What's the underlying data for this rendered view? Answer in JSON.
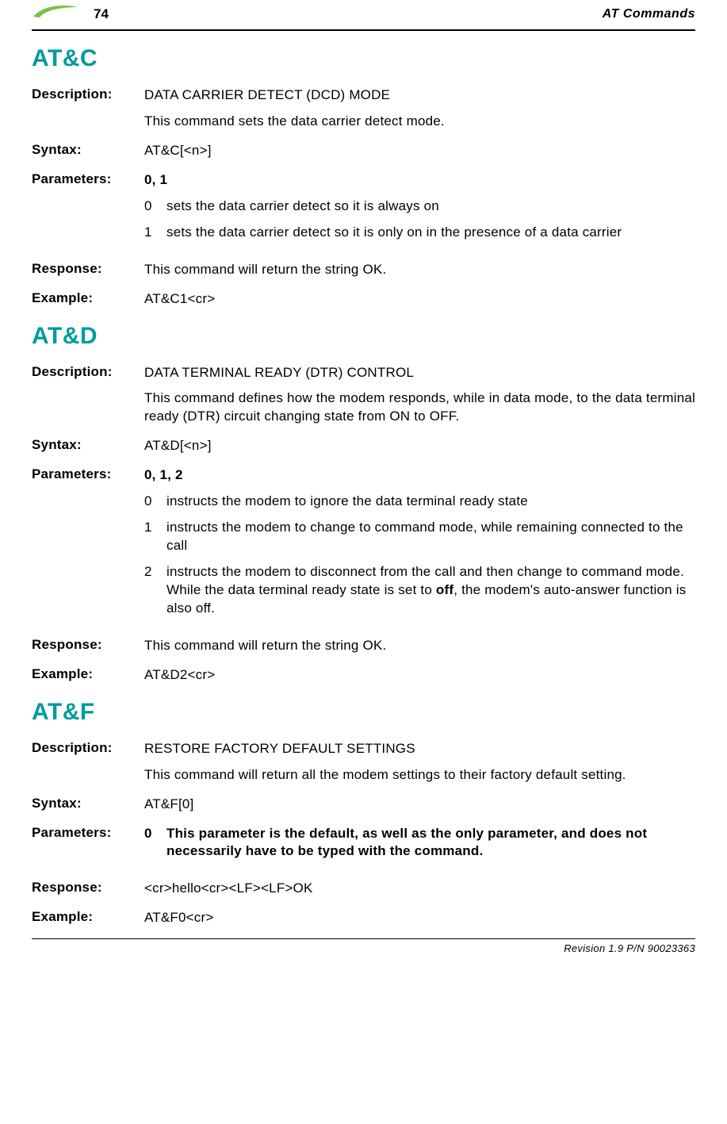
{
  "header": {
    "page_number": "74",
    "title": "AT Commands"
  },
  "logo": {
    "fill": "#7BC043"
  },
  "sections": {
    "atc": {
      "heading": "AT&C",
      "description_label": "Description:",
      "description_title": "DATA CARRIER DETECT (DCD) MODE",
      "description_text": "This command sets the data carrier detect mode.",
      "syntax_label": "Syntax:",
      "syntax_value": "AT&C[<n>]",
      "params_label": "Parameters:",
      "params_value": "0, 1",
      "params_items": [
        {
          "k": "0",
          "v": "sets the data carrier detect so it is always on"
        },
        {
          "k": "1",
          "v": "sets the data carrier detect so it is only on in the presence of a data carrier"
        }
      ],
      "response_label": "Response:",
      "response_value": "This command will return the string OK.",
      "example_label": "Example:",
      "example_value": "AT&C1<cr>"
    },
    "atd": {
      "heading": "AT&D",
      "description_label": "Description:",
      "description_title": "DATA TERMINAL READY (DTR) CONTROL",
      "description_text": "This command defines how the modem responds, while in data mode, to the data terminal ready (DTR) circuit changing state from ON to OFF.",
      "syntax_label": "Syntax:",
      "syntax_value": "AT&D[<n>]",
      "params_label": "Parameters:",
      "params_value": "0, 1, 2",
      "params_items": [
        {
          "k": "0",
          "v": "instructs the modem to ignore the data terminal ready state"
        },
        {
          "k": "1",
          "v": "instructs the modem to change to command mode, while remaining connected to the call"
        }
      ],
      "params_item_2": {
        "k": "2",
        "pre": "instructs the modem to disconnect from the call and then change to command mode. While the data terminal ready state is set to ",
        "bold": "off",
        "post": ", the modem's auto-answer function is also off."
      },
      "response_label": "Response:",
      "response_value": "This command will return the string OK.",
      "example_label": "Example:",
      "example_value": "AT&D2<cr>"
    },
    "atf": {
      "heading": "AT&F",
      "description_label": "Description:",
      "description_title": "RESTORE FACTORY DEFAULT SETTINGS",
      "description_text": "This command will return all the modem settings to their factory default setting.",
      "syntax_label": "Syntax:",
      "syntax_value": "AT&F[0]",
      "params_label": "Parameters:",
      "params_item_0": {
        "k": "0",
        "v": "This parameter is the default, as well as the only parameter, and does not necessarily have to be typed with the command."
      },
      "response_label": "Response:",
      "response_value": "<cr>hello<cr><LF><LF>OK",
      "example_label": "Example:",
      "example_value": "AT&F0<cr>"
    }
  },
  "footer": {
    "text": "Revision 1.9 P/N 90023363"
  }
}
